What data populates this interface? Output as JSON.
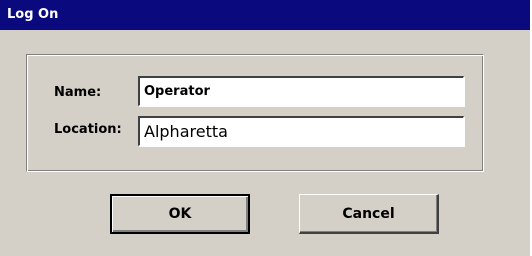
{
  "window": {
    "title": "Log On",
    "titlebar_color": "#0a0a7e",
    "face_color": "#d4d0c8"
  },
  "form": {
    "name_label": "Name:",
    "name_value": "Operator",
    "location_label": "Location:",
    "location_value": "Alpharetta"
  },
  "buttons": {
    "ok_label": "OK",
    "cancel_label": "Cancel"
  }
}
